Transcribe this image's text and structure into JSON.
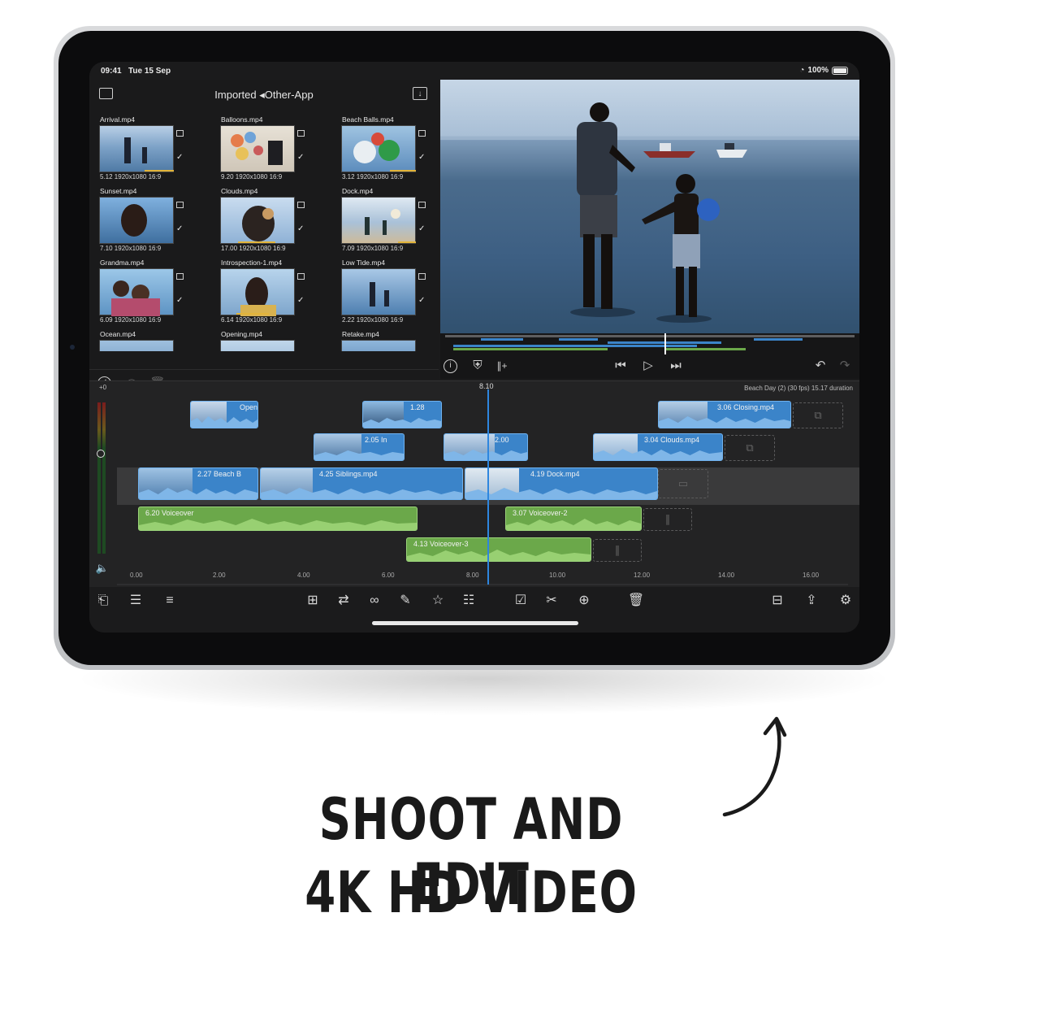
{
  "status_bar": {
    "time": "09:41",
    "date": "Tue 15 Sep",
    "battery": "100%"
  },
  "browser": {
    "title": "Imported ◂Other-App",
    "clips": [
      {
        "name": "Arrival.mp4",
        "meta": "5.12  1920x1080  16:9",
        "used": true
      },
      {
        "name": "Balloons.mp4",
        "meta": "9.20  1920x1080  16:9",
        "used": false
      },
      {
        "name": "Beach Balls.mp4",
        "meta": "3.12  1920x1080  16:9",
        "used": true
      },
      {
        "name": "Sunset.mp4",
        "meta": "7.10  1920x1080  16:9",
        "used": false
      },
      {
        "name": "Clouds.mp4",
        "meta": "17.00  1920x1080  16:9",
        "used": true
      },
      {
        "name": "Dock.mp4",
        "meta": "7.09  1920x1080  16:9",
        "used": true
      },
      {
        "name": "Grandma.mp4",
        "meta": "6.09  1920x1080  16:9",
        "used": false
      },
      {
        "name": "Introspection-1.mp4",
        "meta": "6.14  1920x1080  16:9",
        "used": true
      },
      {
        "name": "Low Tide.mp4",
        "meta": "2.22  1920x1080  16:9",
        "used": false
      },
      {
        "name": "Ocean.mp4",
        "meta": "",
        "used": false
      },
      {
        "name": "Opening.mp4",
        "meta": "",
        "used": false
      },
      {
        "name": "Retake.mp4",
        "meta": "",
        "used": false
      }
    ]
  },
  "timeline": {
    "playhead_time": "8.10",
    "project_info": "Beach Day (2) (30 fps)  15.17 duration",
    "meter_top_label": "+0",
    "ruler": [
      "0.00",
      "2.00",
      "4.00",
      "6.00",
      "8.00",
      "10.00",
      "12.00",
      "14.00",
      "16.00"
    ],
    "clips": {
      "opening": "Open",
      "c128": "1.28",
      "closing": "3.06  Closing.mp4",
      "in": "2.05  In",
      "c200": "2.00",
      "clouds": "3.04  Clouds.mp4",
      "beach": "2.27  Beach B",
      "siblings": "4.25  Siblings.mp4",
      "dock": "4.19  Dock.mp4",
      "voiceover1": "6.20  Voiceover",
      "voiceover2": "3.07  Voiceover-2",
      "voiceover3": "4.13  Voiceover-3"
    }
  },
  "caption": {
    "line1": "SHOOT AND EDIT",
    "line2": "4K HD VIDEO"
  },
  "colors": {
    "clip_blue": "#3b84c9",
    "clip_green": "#6ba84a",
    "playhead": "#2e86de",
    "used_marker": "#e2b43a"
  }
}
